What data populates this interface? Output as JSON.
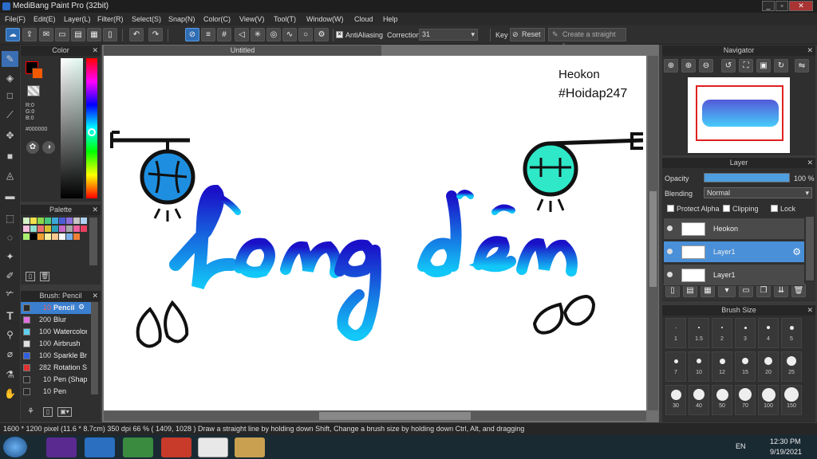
{
  "window": {
    "title": "MediBang Paint Pro (32bit)",
    "minimize": "_",
    "restore": "▫",
    "close": "✕"
  },
  "menu": [
    "File(F)",
    "Edit(E)",
    "Layer(L)",
    "Filter(R)",
    "Select(S)",
    "Snap(N)",
    "Color(C)",
    "View(V)",
    "Tool(T)",
    "Window(W)",
    "Cloud",
    "Help"
  ],
  "toolbar": {
    "antialiasing_label": "AntiAliasing",
    "correction_label": "Correction",
    "correction_value": "31",
    "key_label": "Key",
    "reset_label": "Reset",
    "straight_line_placeholder": "Create a straight line"
  },
  "color_panel": {
    "title": "Color",
    "r": "R:0",
    "g": "G:0",
    "b": "B:0",
    "hex": "#000000"
  },
  "palette_panel": {
    "title": "Palette",
    "swatches": [
      "#d4f2c4",
      "#f4e04c",
      "#8ad84c",
      "#4cc87c",
      "#3ca8d8",
      "#4c5cd8",
      "#8c6cd8",
      "#c4c4c4",
      "#b0d0f0",
      "#f8c0e0",
      "#90e0d0",
      "#f07070",
      "#d8c030",
      "#2ea0b8",
      "#c868c8",
      "#a8a8a8",
      "#f060a0",
      "#e84060",
      "#a8f070",
      "#000000",
      "#f0a030",
      "#f8f0a0",
      "#f8c890",
      "#f8f8f8",
      "#7ab0e8",
      "#f08038"
    ]
  },
  "brush_panel": {
    "title": "Brush: Pencil",
    "items": [
      {
        "size": "10",
        "name": "Pencil",
        "color": "#2a2a2a",
        "selected": true
      },
      {
        "size": "200",
        "name": "Blur",
        "color": "#e070e0",
        "selected": false
      },
      {
        "size": "100",
        "name": "Watercolor",
        "color": "#60d0f0",
        "selected": false
      },
      {
        "size": "100",
        "name": "Airbrush",
        "color": "#e0e0e0",
        "selected": false
      },
      {
        "size": "100",
        "name": "Sparkle Brush",
        "color": "#3060e0",
        "selected": false
      },
      {
        "size": "282",
        "name": "Rotation Symmetry",
        "color": "#e03030",
        "selected": false
      },
      {
        "size": "10",
        "name": "Pen (Shape)",
        "color": "#2a2a2a",
        "selected": false
      },
      {
        "size": "10",
        "name": "Pen",
        "color": "#2a2a2a",
        "selected": false
      }
    ]
  },
  "canvas": {
    "tab_title": "Untitled",
    "watermark_line1": "Heokon",
    "watermark_line2": "#Hoidap247"
  },
  "navigator": {
    "title": "Navigator"
  },
  "layer_panel": {
    "title": "Layer",
    "opacity_label": "Opacity",
    "opacity_value": "100 %",
    "opacity_fraction": 1.0,
    "blending_label": "Blending",
    "blending_value": "Normal",
    "protect_alpha": "Protect Alpha",
    "clipping": "Clipping",
    "lock": "Lock",
    "layers": [
      {
        "name": "Heokon",
        "selected": false
      },
      {
        "name": "Layer1",
        "selected": true
      },
      {
        "name": "Layer1",
        "selected": false
      }
    ]
  },
  "brush_size_panel": {
    "title": "Brush Size",
    "sizes": [
      "1",
      "1.5",
      "2",
      "3",
      "4",
      "5",
      "7",
      "10",
      "12",
      "15",
      "20",
      "25",
      "30",
      "40",
      "50",
      "70",
      "100",
      "150"
    ]
  },
  "status": {
    "text": "1600 * 1200 pixel  (11.6 * 8.7cm)  350 dpi  66 %  ( 1409, 1028 )  Draw a straight line by holding down Shift, Change a brush size by holding down Ctrl, Alt, and dragging"
  },
  "taskbar": {
    "lang": "EN",
    "time": "12:30 PM",
    "date": "9/19/2021"
  },
  "colors": {
    "accent": "#3b7fd0",
    "lantern_blue": "#1e8fe0",
    "lantern_teal": "#2ee8c8",
    "lettering_dark": "#1818c8",
    "lettering_light": "#10b8f8"
  }
}
